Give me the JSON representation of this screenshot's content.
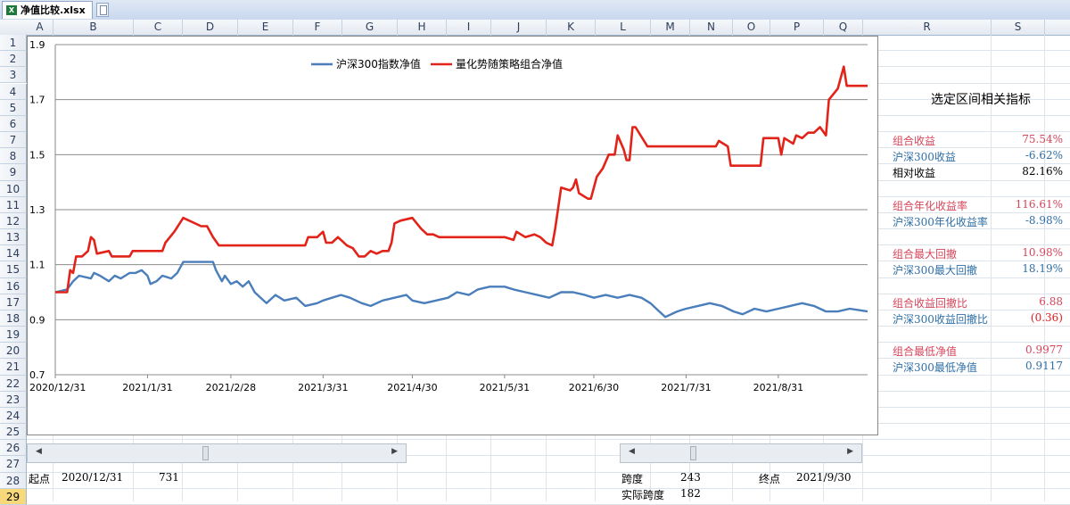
{
  "window": {
    "file_tab": "净值比较.xlsx *",
    "excel_icon": "X"
  },
  "columns": [
    "A",
    "B",
    "C",
    "D",
    "E",
    "F",
    "G",
    "H",
    "I",
    "J",
    "K",
    "L",
    "M",
    "N",
    "O",
    "P",
    "Q",
    "R",
    "S"
  ],
  "rows": [
    "1",
    "2",
    "3",
    "4",
    "5",
    "6",
    "7",
    "8",
    "9",
    "10",
    "11",
    "12",
    "13",
    "14",
    "15",
    "16",
    "17",
    "18",
    "19",
    "20",
    "21",
    "22",
    "23",
    "24",
    "25",
    "26",
    "27",
    "28",
    "29"
  ],
  "selected_row": "29",
  "panel": {
    "title": "选定区间相关指标",
    "metrics": [
      {
        "label": "组合收益",
        "value": "75.54%",
        "color": "#d6455a"
      },
      {
        "label": "沪深300收益",
        "value": "-6.62%",
        "color": "#2e6fa7"
      },
      {
        "label": "相对收益",
        "value": "82.16%",
        "color": "#000000"
      },
      {
        "label": "组合年化收益率",
        "value": "116.61%",
        "color": "#d6455a"
      },
      {
        "label": "沪深300年化收益率",
        "value": "-8.98%",
        "color": "#2e6fa7"
      },
      {
        "label": "组合最大回撤",
        "value": "10.98%",
        "color": "#d6455a"
      },
      {
        "label": "沪深300最大回撤",
        "value": "18.19%",
        "color": "#2e6fa7"
      },
      {
        "label": "组合收益回撤比",
        "value": "6.88",
        "color": "#d6455a"
      },
      {
        "label": "沪深300收益回撤比",
        "value": "(0.36)",
        "color": "#2e6fa7",
        "value_color": "#e02020"
      },
      {
        "label": "组合最低净值",
        "value": "0.9977",
        "color": "#d6455a"
      },
      {
        "label": "沪深300最低净值",
        "value": "0.9117",
        "color": "#2e6fa7"
      }
    ]
  },
  "bottom": {
    "start_label": "起点",
    "start_date": "2020/12/31",
    "start_index": "731",
    "span_label": "跨度",
    "span_value": "243",
    "end_label": "终点",
    "end_date": "2021/9/30",
    "actual_span_label": "实际跨度",
    "actual_span_value": "182"
  },
  "chart_data": {
    "type": "line",
    "y_ticks": [
      "1.9",
      "1.7",
      "1.5",
      "1.3",
      "1.1",
      "0.9",
      "0.7"
    ],
    "ylim": [
      0.7,
      1.9
    ],
    "x_ticks": [
      "2020/12/31",
      "2021/1/31",
      "2021/2/28",
      "2021/3/31",
      "2021/4/30",
      "2021/5/31",
      "2021/6/30",
      "2021/7/31",
      "2021/8/31"
    ],
    "xlim": [
      "2020/12/31",
      "2021/9/30"
    ],
    "grid": true,
    "legend": "top-center",
    "series": [
      {
        "name": "沪深300指数净值",
        "color": "#4a7ebb",
        "points": [
          [
            "2020/12/31",
            1.0
          ],
          [
            "2021/1/4",
            1.01
          ],
          [
            "2021/1/6",
            1.04
          ],
          [
            "2021/1/8",
            1.06
          ],
          [
            "2021/1/12",
            1.05
          ],
          [
            "2021/1/13",
            1.07
          ],
          [
            "2021/1/15",
            1.06
          ],
          [
            "2021/1/18",
            1.04
          ],
          [
            "2021/1/20",
            1.06
          ],
          [
            "2021/1/22",
            1.05
          ],
          [
            "2021/1/25",
            1.07
          ],
          [
            "2021/1/27",
            1.07
          ],
          [
            "2021/1/29",
            1.08
          ],
          [
            "2021/1/31",
            1.06
          ],
          [
            "2021/2/1",
            1.03
          ],
          [
            "2021/2/3",
            1.04
          ],
          [
            "2021/2/5",
            1.06
          ],
          [
            "2021/2/8",
            1.05
          ],
          [
            "2021/2/10",
            1.07
          ],
          [
            "2021/2/12",
            1.11
          ],
          [
            "2021/2/18",
            1.11
          ],
          [
            "2021/2/22",
            1.11
          ],
          [
            "2021/2/23",
            1.08
          ],
          [
            "2021/2/25",
            1.04
          ],
          [
            "2021/2/26",
            1.06
          ],
          [
            "2021/2/28",
            1.03
          ],
          [
            "2021/3/2",
            1.04
          ],
          [
            "2021/3/4",
            1.02
          ],
          [
            "2021/3/6",
            1.04
          ],
          [
            "2021/3/8",
            1.0
          ],
          [
            "2021/3/10",
            0.98
          ],
          [
            "2021/3/12",
            0.96
          ],
          [
            "2021/3/15",
            0.99
          ],
          [
            "2021/3/18",
            0.97
          ],
          [
            "2021/3/22",
            0.98
          ],
          [
            "2021/3/25",
            0.95
          ],
          [
            "2021/3/29",
            0.96
          ],
          [
            "2021/3/31",
            0.97
          ],
          [
            "2021/4/3",
            0.98
          ],
          [
            "2021/4/6",
            0.99
          ],
          [
            "2021/4/9",
            0.98
          ],
          [
            "2021/4/13",
            0.96
          ],
          [
            "2021/4/16",
            0.95
          ],
          [
            "2021/4/20",
            0.97
          ],
          [
            "2021/4/24",
            0.98
          ],
          [
            "2021/4/28",
            0.99
          ],
          [
            "2021/4/30",
            0.97
          ],
          [
            "2021/5/4",
            0.96
          ],
          [
            "2021/5/8",
            0.97
          ],
          [
            "2021/5/12",
            0.98
          ],
          [
            "2021/5/15",
            1.0
          ],
          [
            "2021/5/19",
            0.99
          ],
          [
            "2021/5/22",
            1.01
          ],
          [
            "2021/5/26",
            1.02
          ],
          [
            "2021/5/31",
            1.02
          ],
          [
            "2021/6/3",
            1.01
          ],
          [
            "2021/6/7",
            1.0
          ],
          [
            "2021/6/11",
            0.99
          ],
          [
            "2021/6/15",
            0.98
          ],
          [
            "2021/6/19",
            1.0
          ],
          [
            "2021/6/23",
            1.0
          ],
          [
            "2021/6/27",
            0.99
          ],
          [
            "2021/6/30",
            0.98
          ],
          [
            "2021/7/4",
            0.99
          ],
          [
            "2021/7/8",
            0.98
          ],
          [
            "2021/7/12",
            0.99
          ],
          [
            "2021/7/16",
            0.98
          ],
          [
            "2021/7/19",
            0.96
          ],
          [
            "2021/7/22",
            0.93
          ],
          [
            "2021/7/24",
            0.91
          ],
          [
            "2021/7/28",
            0.93
          ],
          [
            "2021/7/31",
            0.94
          ],
          [
            "2021/8/4",
            0.95
          ],
          [
            "2021/8/8",
            0.96
          ],
          [
            "2021/8/12",
            0.95
          ],
          [
            "2021/8/16",
            0.93
          ],
          [
            "2021/8/19",
            0.92
          ],
          [
            "2021/8/23",
            0.94
          ],
          [
            "2021/8/27",
            0.93
          ],
          [
            "2021/8/31",
            0.94
          ],
          [
            "2021/9/4",
            0.95
          ],
          [
            "2021/9/8",
            0.96
          ],
          [
            "2021/9/12",
            0.95
          ],
          [
            "2021/9/16",
            0.93
          ],
          [
            "2021/9/20",
            0.93
          ],
          [
            "2021/9/24",
            0.94
          ],
          [
            "2021/9/30",
            0.93
          ]
        ]
      },
      {
        "name": "量化势随策略组合净值",
        "color": "#e2231a",
        "points": [
          [
            "2020/12/31",
            1.0
          ],
          [
            "2021/1/4",
            1.0
          ],
          [
            "2021/1/5",
            1.08
          ],
          [
            "2021/1/6",
            1.07
          ],
          [
            "2021/1/7",
            1.13
          ],
          [
            "2021/1/9",
            1.13
          ],
          [
            "2021/1/11",
            1.15
          ],
          [
            "2021/1/12",
            1.2
          ],
          [
            "2021/1/13",
            1.19
          ],
          [
            "2021/1/14",
            1.14
          ],
          [
            "2021/1/18",
            1.15
          ],
          [
            "2021/1/19",
            1.13
          ],
          [
            "2021/1/22",
            1.13
          ],
          [
            "2021/1/25",
            1.13
          ],
          [
            "2021/1/26",
            1.15
          ],
          [
            "2021/2/3",
            1.15
          ],
          [
            "2021/2/5",
            1.15
          ],
          [
            "2021/2/6",
            1.18
          ],
          [
            "2021/2/9",
            1.22
          ],
          [
            "2021/2/12",
            1.27
          ],
          [
            "2021/2/18",
            1.24
          ],
          [
            "2021/2/20",
            1.24
          ],
          [
            "2021/2/22",
            1.2
          ],
          [
            "2021/2/24",
            1.17
          ],
          [
            "2021/3/1",
            1.17
          ],
          [
            "2021/3/20",
            1.17
          ],
          [
            "2021/3/25",
            1.17
          ],
          [
            "2021/3/26",
            1.2
          ],
          [
            "2021/3/29",
            1.2
          ],
          [
            "2021/3/31",
            1.22
          ],
          [
            "2021/4/1",
            1.18
          ],
          [
            "2021/4/3",
            1.18
          ],
          [
            "2021/4/5",
            1.2
          ],
          [
            "2021/4/8",
            1.17
          ],
          [
            "2021/4/10",
            1.16
          ],
          [
            "2021/4/12",
            1.13
          ],
          [
            "2021/4/14",
            1.13
          ],
          [
            "2021/4/16",
            1.15
          ],
          [
            "2021/4/18",
            1.14
          ],
          [
            "2021/4/20",
            1.15
          ],
          [
            "2021/4/22",
            1.15
          ],
          [
            "2021/4/23",
            1.18
          ],
          [
            "2021/4/24",
            1.25
          ],
          [
            "2021/4/26",
            1.26
          ],
          [
            "2021/4/30",
            1.27
          ],
          [
            "2021/5/3",
            1.23
          ],
          [
            "2021/5/5",
            1.21
          ],
          [
            "2021/5/7",
            1.21
          ],
          [
            "2021/5/9",
            1.2
          ],
          [
            "2021/5/31",
            1.2
          ],
          [
            "2021/6/3",
            1.19
          ],
          [
            "2021/6/4",
            1.22
          ],
          [
            "2021/6/7",
            1.2
          ],
          [
            "2021/6/10",
            1.21
          ],
          [
            "2021/6/12",
            1.2
          ],
          [
            "2021/6/14",
            1.18
          ],
          [
            "2021/6/16",
            1.17
          ],
          [
            "2021/6/17",
            1.23
          ],
          [
            "2021/6/19",
            1.38
          ],
          [
            "2021/6/22",
            1.37
          ],
          [
            "2021/6/23",
            1.38
          ],
          [
            "2021/6/24",
            1.41
          ],
          [
            "2021/6/25",
            1.36
          ],
          [
            "2021/6/28",
            1.34
          ],
          [
            "2021/6/29",
            1.34
          ],
          [
            "2021/7/1",
            1.42
          ],
          [
            "2021/7/3",
            1.45
          ],
          [
            "2021/7/5",
            1.5
          ],
          [
            "2021/7/7",
            1.5
          ],
          [
            "2021/7/8",
            1.57
          ],
          [
            "2021/7/10",
            1.52
          ],
          [
            "2021/7/11",
            1.48
          ],
          [
            "2021/7/12",
            1.48
          ],
          [
            "2021/7/13",
            1.6
          ],
          [
            "2021/7/14",
            1.6
          ],
          [
            "2021/7/18",
            1.53
          ],
          [
            "2021/8/10",
            1.53
          ],
          [
            "2021/8/11",
            1.55
          ],
          [
            "2021/8/14",
            1.53
          ],
          [
            "2021/8/15",
            1.46
          ],
          [
            "2021/8/25",
            1.46
          ],
          [
            "2021/8/26",
            1.56
          ],
          [
            "2021/8/31",
            1.56
          ],
          [
            "2021/9/1",
            1.5
          ],
          [
            "2021/9/2",
            1.56
          ],
          [
            "2021/9/5",
            1.54
          ],
          [
            "2021/9/6",
            1.57
          ],
          [
            "2021/9/8",
            1.56
          ],
          [
            "2021/9/10",
            1.58
          ],
          [
            "2021/9/12",
            1.58
          ],
          [
            "2021/9/14",
            1.6
          ],
          [
            "2021/9/16",
            1.57
          ],
          [
            "2021/9/17",
            1.7
          ],
          [
            "2021/9/20",
            1.74
          ],
          [
            "2021/9/22",
            1.82
          ],
          [
            "2021/9/23",
            1.75
          ],
          [
            "2021/9/30",
            1.75
          ]
        ]
      }
    ]
  }
}
